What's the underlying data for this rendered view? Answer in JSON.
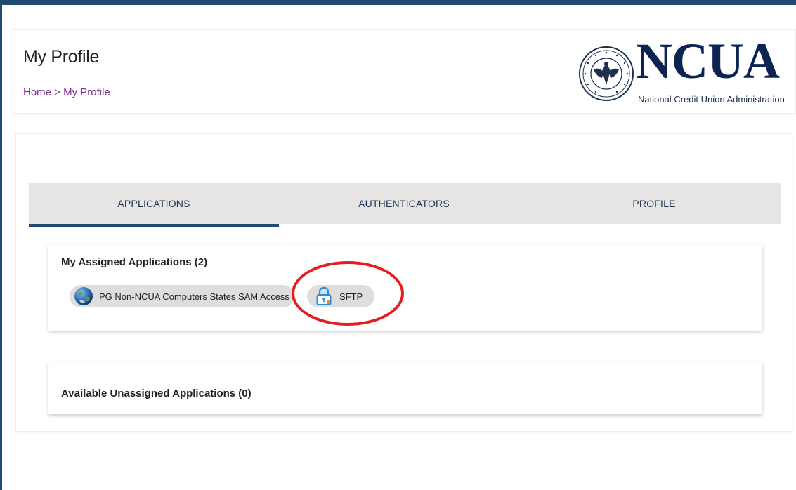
{
  "header": {
    "title": "My Profile",
    "breadcrumb": {
      "home": "Home",
      "separator": " > ",
      "current": "My Profile"
    },
    "brand": {
      "name": "NCUA",
      "subtitle": "National Credit Union Administration"
    }
  },
  "tabs": [
    {
      "label": "APPLICATIONS",
      "active": true
    },
    {
      "label": "AUTHENTICATORS",
      "active": false
    },
    {
      "label": "PROFILE",
      "active": false
    }
  ],
  "assigned": {
    "title": "My Assigned Applications (2)",
    "apps": [
      {
        "name": "PG Non-NCUA Computers States SAM Access",
        "icon": "globe-icon"
      },
      {
        "name": "SFTP",
        "icon": "lock-icon"
      }
    ]
  },
  "unassigned": {
    "title": "Available Unassigned Applications (0)"
  },
  "colors": {
    "brand_navy": "#0b2452",
    "top_bar": "#1f4a72",
    "breadcrumb": "#7a2a8c",
    "tab_bg": "#e6e5e3",
    "highlight": "#e41e1e"
  }
}
